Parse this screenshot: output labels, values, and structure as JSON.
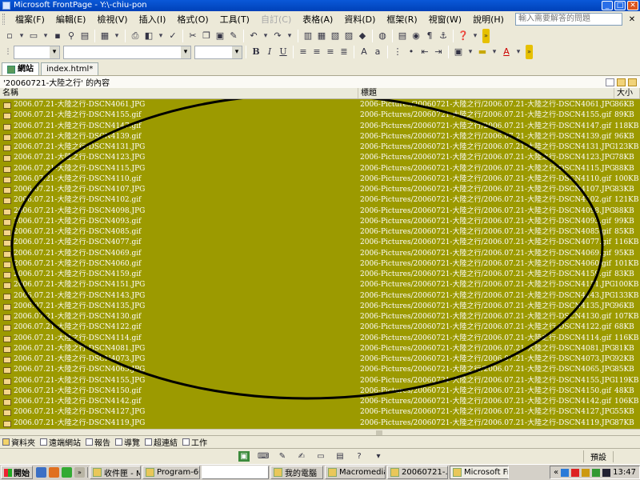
{
  "window": {
    "title": "Microsoft FrontPage - Y:\\-chiu-pon",
    "minimize": "_",
    "maximize": "□",
    "close": "✕"
  },
  "menu": {
    "items": [
      {
        "label": "檔案(F)",
        "enabled": true
      },
      {
        "label": "編輯(E)",
        "enabled": true
      },
      {
        "label": "檢視(V)",
        "enabled": true
      },
      {
        "label": "插入(I)",
        "enabled": true
      },
      {
        "label": "格式(O)",
        "enabled": true
      },
      {
        "label": "工具(T)",
        "enabled": true
      },
      {
        "label": "自訂(C)",
        "enabled": false
      },
      {
        "label": "表格(A)",
        "enabled": true
      },
      {
        "label": "資料(D)",
        "enabled": true
      },
      {
        "label": "框架(R)",
        "enabled": true
      },
      {
        "label": "視窗(W)",
        "enabled": true
      },
      {
        "label": "說明(H)",
        "enabled": true
      }
    ],
    "help_placeholder": "輸入需要解答的問題",
    "doc_close": "✕"
  },
  "toolbar": {
    "font_size_value": "",
    "bold": "B",
    "italic": "I",
    "underline": "U",
    "font_color_letter": "A"
  },
  "tabs": [
    {
      "label": "網站",
      "active": true
    },
    {
      "label": "index.html*",
      "active": false
    }
  ],
  "folder": {
    "title": "'20060721-大陸之行' 的內容"
  },
  "columns": {
    "name": "名稱",
    "title": "標題",
    "size": "大小"
  },
  "files": [
    {
      "name": "2006.07.21-大陸之行-DSCN4061.JPG",
      "title": "2006-Pictures/20060721-大陸之行/2006.07.21-大陸之行-DSCN4061.JPG",
      "size": "86KB"
    },
    {
      "name": "2006.07.21-大陸之行-DSCN4155.gif",
      "title": "2006-Pictures/20060721-大陸之行/2006.07.21-大陸之行-DSCN4155.gif",
      "size": "89KB"
    },
    {
      "name": "2006.07.21-大陸之行-DSCN4147.gif",
      "title": "2006-Pictures/20060721-大陸之行/2006.07.21-大陸之行-DSCN4147.gif",
      "size": "118KB"
    },
    {
      "name": "2006.07.21-大陸之行-DSCN4139.gif",
      "title": "2006-Pictures/20060721-大陸之行/2006.07.21-大陸之行-DSCN4139.gif",
      "size": "96KB"
    },
    {
      "name": "2006.07.21-大陸之行-DSCN4131.JPG",
      "title": "2006-Pictures/20060721-大陸之行/2006.07.21-大陸之行-DSCN4131.JPG",
      "size": "123KB"
    },
    {
      "name": "2006.07.21-大陸之行-DSCN4123.JPG",
      "title": "2006-Pictures/20060721-大陸之行/2006.07.21-大陸之行-DSCN4123.JPG",
      "size": "78KB"
    },
    {
      "name": "2006.07.21-大陸之行-DSCN4115.JPG",
      "title": "2006-Pictures/20060721-大陸之行/2006.07.21-大陸之行-DSCN4115.JPG",
      "size": "88KB"
    },
    {
      "name": "2006.07.21-大陸之行-DSCN4110.gif",
      "title": "2006-Pictures/20060721-大陸之行/2006.07.21-大陸之行-DSCN4110.gif",
      "size": "100KB"
    },
    {
      "name": "2006.07.21-大陸之行-DSCN4107.JPG",
      "title": "2006-Pictures/20060721-大陸之行/2006.07.21-大陸之行-DSCN4107.JPG",
      "size": "83KB"
    },
    {
      "name": "2006.07.21-大陸之行-DSCN4102.gif",
      "title": "2006-Pictures/20060721-大陸之行/2006.07.21-大陸之行-DSCN4102.gif",
      "size": "121KB"
    },
    {
      "name": "2006.07.21-大陸之行-DSCN4098.JPG",
      "title": "2006-Pictures/20060721-大陸之行/2006.07.21-大陸之行-DSCN4098.JPG",
      "size": "88KB"
    },
    {
      "name": "2006.07.21-大陸之行-DSCN4093.gif",
      "title": "2006-Pictures/20060721-大陸之行/2006.07.21-大陸之行-DSCN4093.gif",
      "size": "99KB"
    },
    {
      "name": "2006.07.21-大陸之行-DSCN4085.gif",
      "title": "2006-Pictures/20060721-大陸之行/2006.07.21-大陸之行-DSCN4085.gif",
      "size": "85KB"
    },
    {
      "name": "2006.07.21-大陸之行-DSCN4077.gif",
      "title": "2006-Pictures/20060721-大陸之行/2006.07.21-大陸之行-DSCN4077.gif",
      "size": "116KB"
    },
    {
      "name": "2006.07.21-大陸之行-DSCN4069.gif",
      "title": "2006-Pictures/20060721-大陸之行/2006.07.21-大陸之行-DSCN4069.gif",
      "size": "95KB"
    },
    {
      "name": "2006.07.21-大陸之行-DSCN4060.gif",
      "title": "2006-Pictures/20060721-大陸之行/2006.07.21-大陸之行-DSCN4060.gif",
      "size": "101KB"
    },
    {
      "name": "2006.07.21-大陸之行-DSCN4159.gif",
      "title": "2006-Pictures/20060721-大陸之行/2006.07.21-大陸之行-DSCN4159.gif",
      "size": "83KB"
    },
    {
      "name": "2006.07.21-大陸之行-DSCN4151.JPG",
      "title": "2006-Pictures/20060721-大陸之行/2006.07.21-大陸之行-DSCN4151.JPG",
      "size": "100KB"
    },
    {
      "name": "2006.07.21-大陸之行-DSCN4143.JPG",
      "title": "2006-Pictures/20060721-大陸之行/2006.07.21-大陸之行-DSCN4143.JPG",
      "size": "133KB"
    },
    {
      "name": "2006.07.21-大陸之行-DSCN4135.JPG",
      "title": "2006-Pictures/20060721-大陸之行/2006.07.21-大陸之行-DSCN4135.JPG",
      "size": "96KB"
    },
    {
      "name": "2006.07.21-大陸之行-DSCN4130.gif",
      "title": "2006-Pictures/20060721-大陸之行/2006.07.21-大陸之行-DSCN4130.gif",
      "size": "107KB"
    },
    {
      "name": "2006.07.21-大陸之行-DSCN4122.gif",
      "title": "2006-Pictures/20060721-大陸之行/2006.07.21-大陸之行-DSCN4122.gif",
      "size": "68KB"
    },
    {
      "name": "2006.07.21-大陸之行-DSCN4114.gif",
      "title": "2006-Pictures/20060721-大陸之行/2006.07.21-大陸之行-DSCN4114.gif",
      "size": "116KB"
    },
    {
      "name": "2006.07.21-大陸之行-DSCN4081.JPG",
      "title": "2006-Pictures/20060721-大陸之行/2006.07.21-大陸之行-DSCN4081.JPG",
      "size": "81KB"
    },
    {
      "name": "2006.07.21-大陸之行-DSCN4073.JPG",
      "title": "2006-Pictures/20060721-大陸之行/2006.07.21-大陸之行-DSCN4073.JPG",
      "size": "92KB"
    },
    {
      "name": "2006.07.21-大陸之行-DSCN4065.JPG",
      "title": "2006-Pictures/20060721-大陸之行/2006.07.21-大陸之行-DSCN4065.JPG",
      "size": "85KB"
    },
    {
      "name": "2006.07.21-大陸之行-DSCN4155.JPG",
      "title": "2006-Pictures/20060721-大陸之行/2006.07.21-大陸之行-DSCN4155.JPG",
      "size": "119KB"
    },
    {
      "name": "2006.07.21-大陸之行-DSCN4150.gif",
      "title": "2006-Pictures/20060721-大陸之行/2006.07.21-大陸之行-DSCN4150.gif",
      "size": "48KB"
    },
    {
      "name": "2006.07.21-大陸之行-DSCN4142.gif",
      "title": "2006-Pictures/20060721-大陸之行/2006.07.21-大陸之行-DSCN4142.gif",
      "size": "106KB"
    },
    {
      "name": "2006.07.21-大陸之行-DSCN4127.JPG",
      "title": "2006-Pictures/20060721-大陸之行/2006.07.21-大陸之行-DSCN4127.JPG",
      "size": "55KB"
    },
    {
      "name": "2006.07.21-大陸之行-DSCN4119.JPG",
      "title": "2006-Pictures/20060721-大陸之行/2006.07.21-大陸之行-DSCN4119.JPG",
      "size": "87KB"
    }
  ],
  "views": [
    {
      "label": "資料夾",
      "active": true
    },
    {
      "label": "遠端網站",
      "active": false
    },
    {
      "label": "報告",
      "active": false
    },
    {
      "label": "導覽",
      "active": false
    },
    {
      "label": "超連結",
      "active": false
    },
    {
      "label": "工作",
      "active": false
    }
  ],
  "status": {
    "preset": "預設"
  },
  "taskbar": {
    "start": "開始",
    "tasks": [
      {
        "label": "收件匣 - Mi...",
        "active": false
      },
      {
        "label": "Program-60...",
        "active": false
      },
      {
        "label": "",
        "active": false,
        "blank": true
      },
      {
        "label": "我的電腦",
        "active": false
      },
      {
        "label": "Macromedia...",
        "active": false
      },
      {
        "label": "20060721-...",
        "active": false
      },
      {
        "label": "Microsoft Fr...",
        "active": true
      }
    ],
    "clock": "13:47"
  },
  "colors": {
    "list_highlight": "#9c9a00",
    "annotation_ellipse": "#000000"
  }
}
